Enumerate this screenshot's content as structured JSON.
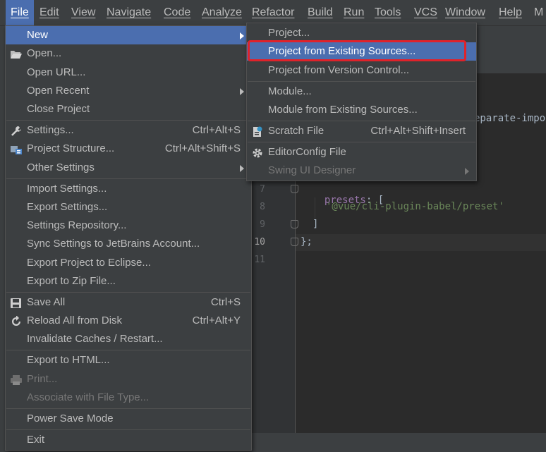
{
  "menubar": {
    "items": [
      "File",
      "Edit",
      "View",
      "Navigate",
      "Code",
      "Analyze",
      "Refactor",
      "Build",
      "Run",
      "Tools",
      "VCS",
      "Window",
      "Help"
    ],
    "trailing": "M"
  },
  "file_menu": {
    "new": "New",
    "open": "Open...",
    "open_url": "Open URL...",
    "open_recent": "Open Recent",
    "close_project": "Close Project",
    "settings": "Settings...",
    "settings_sc": "Ctrl+Alt+S",
    "project_structure": "Project Structure...",
    "project_structure_sc": "Ctrl+Alt+Shift+S",
    "other_settings": "Other Settings",
    "import_settings": "Import Settings...",
    "export_settings": "Export Settings...",
    "settings_repository": "Settings Repository...",
    "sync_settings": "Sync Settings to JetBrains Account...",
    "export_eclipse": "Export Project to Eclipse...",
    "export_zip": "Export to Zip File...",
    "save_all": "Save All",
    "save_all_sc": "Ctrl+S",
    "reload": "Reload All from Disk",
    "reload_sc": "Ctrl+Alt+Y",
    "invalidate": "Invalidate Caches / Restart...",
    "export_html": "Export to HTML...",
    "print": "Print...",
    "associate": "Associate with File Type...",
    "power_save": "Power Save Mode",
    "exit": "Exit"
  },
  "new_submenu": {
    "project": "Project...",
    "project_existing": "Project from Existing Sources...",
    "project_vcs": "Project from Version Control...",
    "module": "Module...",
    "module_existing": "Module from Existing Sources...",
    "scratch": "Scratch File",
    "scratch_sc": "Ctrl+Alt+Shift+Insert",
    "editorconfig": "EditorConfig File",
    "swing": "Swing UI Designer"
  },
  "editor": {
    "line_numbers": [
      "7",
      "8",
      "9",
      "10",
      "11"
    ],
    "overflow_text": "eparate-impo",
    "line7_key": "presets",
    "line7_punc": ": [",
    "line8_str": "'@vue/cli-plugin-babel/preset'",
    "line9": "]",
    "line10": "};"
  },
  "colors": {
    "selection": "#4b6eaf",
    "highlight_box": "#e0222a",
    "menu_bg": "#3c3f41",
    "editor_bg": "#2b2b2b"
  },
  "icons": [
    "folder-open-icon",
    "wrench-icon",
    "project-structure-icon",
    "save-icon",
    "reload-icon",
    "printer-icon",
    "scratch-file-icon",
    "gear-icon",
    "submenu-arrow-icon"
  ]
}
